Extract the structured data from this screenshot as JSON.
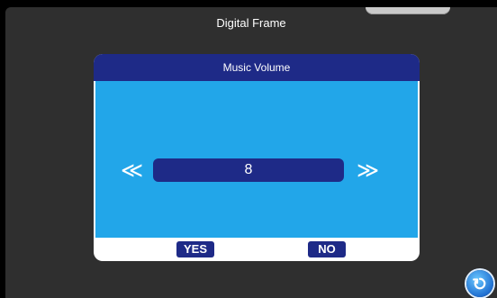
{
  "header": {
    "title": "Digital Frame"
  },
  "dialog": {
    "title": "Music Volume",
    "value": "8",
    "left_arrow": "≪",
    "right_arrow": "≫",
    "buttons": {
      "yes": "YES",
      "no": "NO"
    }
  },
  "colors": {
    "navy": "#1e2a87",
    "blue": "#22a6e9",
    "background": "#2f2f2f"
  },
  "icons": {
    "back": "return-icon"
  }
}
